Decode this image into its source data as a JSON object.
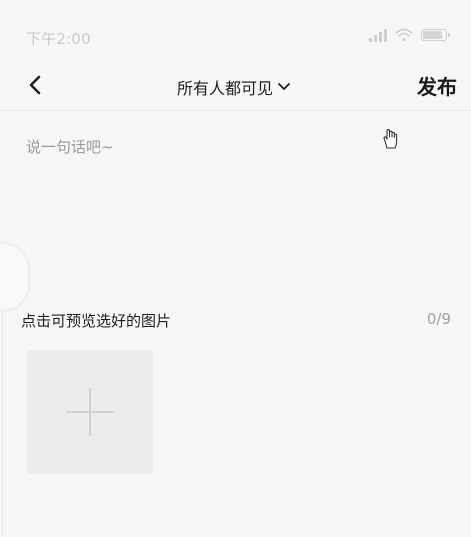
{
  "status_bar": {
    "time": "下午2:00",
    "battery_level": 0.9
  },
  "nav": {
    "visibility_label": "所有人都可见",
    "publish_label": "发布"
  },
  "composer": {
    "placeholder": "说一句话吧~",
    "value": ""
  },
  "photos": {
    "hint": "点击可预览选好的图片",
    "count": "0/9"
  },
  "colors": {
    "background": "#f7f7f7",
    "tile": "#ececec",
    "text_primary": "#1e1e1e",
    "text_muted": "#9a9a9a"
  }
}
